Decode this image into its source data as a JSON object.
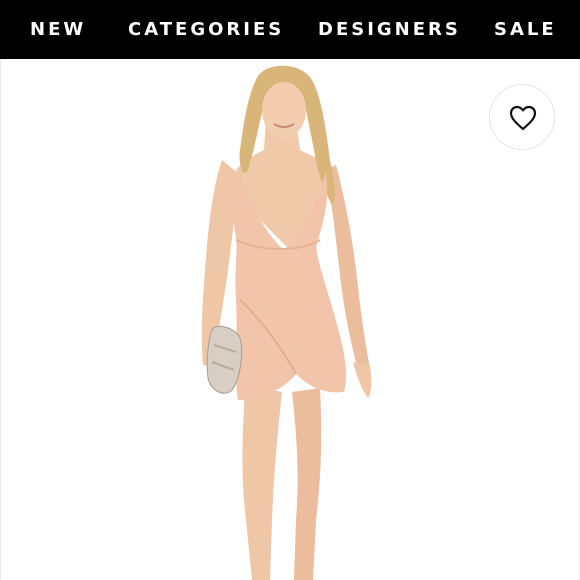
{
  "nav": {
    "items": [
      {
        "label": "NEW"
      },
      {
        "label": "CATEGORIES"
      },
      {
        "label": "DESIGNERS"
      },
      {
        "label": "SALE"
      }
    ]
  },
  "product": {
    "favorite_icon": "heart-outline-icon",
    "dress_color": "#f2c4aa",
    "skin_color": "#f0c9a8",
    "hair_color": "#d9b57a",
    "clutch_color": "#d7cfc3"
  },
  "colors": {
    "nav_background": "#000000",
    "nav_text": "#ffffff",
    "page_background": "#ffffff"
  }
}
